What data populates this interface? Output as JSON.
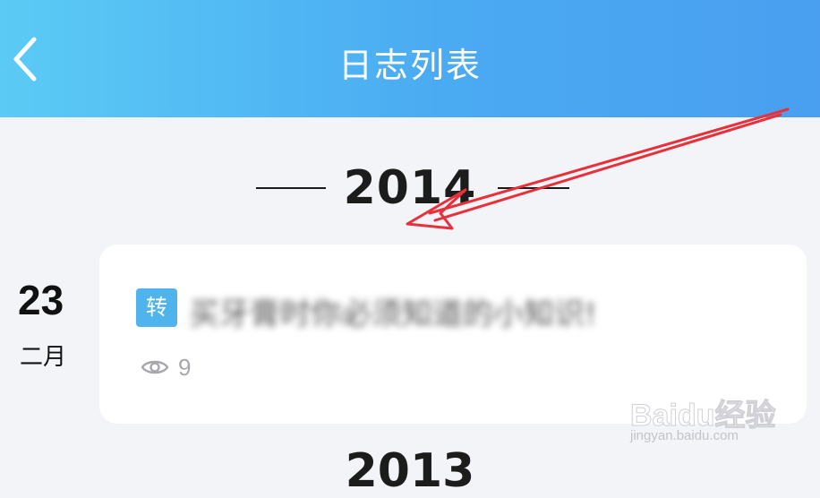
{
  "header": {
    "title": "日志列表",
    "back_icon": "chevron-left-icon"
  },
  "timeline": {
    "year": "2014",
    "next_year": "2013"
  },
  "entry": {
    "day": "23",
    "month": "二月",
    "tag": "转",
    "title": "买牙膏时你必须知道的小知识!",
    "views": "9",
    "views_icon": "eye-icon"
  },
  "watermark": {
    "logo": "Baidu经验",
    "url": "jingyan.baidu.com"
  },
  "colors": {
    "header_start": "#5bcbf5",
    "header_end": "#4a9ff0",
    "tag_bg": "#4fb3ee",
    "annotation_arrow": "#e8303a"
  }
}
